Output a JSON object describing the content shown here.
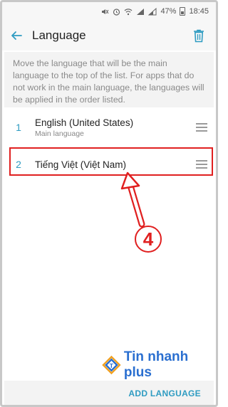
{
  "status_bar": {
    "battery": "47%",
    "time": "18:45"
  },
  "app_bar": {
    "title": "Language"
  },
  "description": "Move the language that will be the main language to the top of the list. For apps that do not work in the main language, the languages will be applied in the order listed.",
  "languages": [
    {
      "index": "1",
      "name": "English (United States)",
      "sub": "Main language"
    },
    {
      "index": "2",
      "name": "Tiếng Việt (Việt Nam)",
      "sub": ""
    }
  ],
  "annotation": {
    "step": "4"
  },
  "watermark": {
    "text": "Tin nhanh plus"
  },
  "footer": {
    "add_label": "ADD LANGUAGE"
  },
  "colors": {
    "accent": "#2f9cc2",
    "annotation": "#e02020",
    "watermark": "#2a6fd0"
  }
}
